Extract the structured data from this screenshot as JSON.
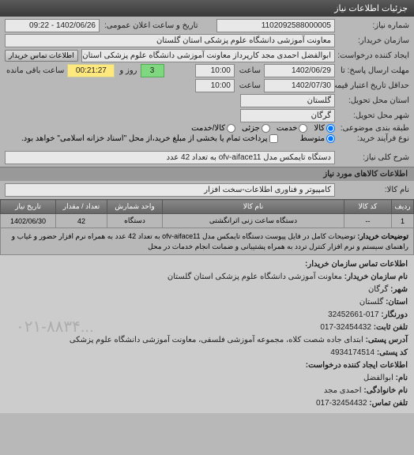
{
  "header": {
    "title": "جزئیات اطلاعات نیاز"
  },
  "form": {
    "request_no_label": "شماره نیاز:",
    "request_no": "1102092588000005",
    "announce_label": "تاریخ و ساعت اعلان عمومی:",
    "announce_value": "1402/06/26 - 09:22",
    "buyer_org_label": "سازمان خریدار:",
    "buyer_org": "معاونت آموزشی دانشگاه علوم پزشکی استان گلستان",
    "requester_label": "ایجاد کننده درخواست:",
    "requester": "ابوالفضل احمدی مجد کارپرداز معاونت آموزشی دانشگاه علوم پزشکی استان گل",
    "contact_btn": "اطلاعات تماس خریدار",
    "deadline_from_label": "مهلت ارسال پاسخ: تا",
    "deadline_date": "1402/06/29",
    "time_label": "ساعت",
    "deadline_time": "10:00",
    "days_field": "3",
    "days_label": "روز و",
    "remain_time": "00:21:27",
    "remain_label": "ساعت باقی مانده",
    "valid_until_label": "حداقل تاریخ اعتبار قیمت: تا تاریخ:",
    "valid_date": "1402/07/30",
    "valid_time": "10:00",
    "province_label": "استان محل تحویل:",
    "province": "گلستان",
    "city_label": "شهر محل تحویل:",
    "city": "گرگان",
    "category_label": "طبقه بندی موضوعی:",
    "cat_goods": "کالا",
    "cat_service": "خدمت",
    "cat_partial": "جزئی",
    "cat_goods_service": "کالا/خدمت",
    "process_label": "نوع فرآیند خرید:",
    "proc_mid": "متوسط",
    "pay_note": "پرداخت تمام یا بخشی از مبلغ خرید،از محل \"اسناد خزانه اسلامی\" خواهد بود.",
    "desc_label": "شرح کلی نیاز:",
    "desc_value": "دستگاه تایمکس مدل ofv-aiface11 به تعداد 42 عدد"
  },
  "goods_section": {
    "title": "اطلاعات کالاهای مورد نیاز",
    "group_label": "نام کالا:",
    "group_value": "کامپیوتر و فناوری اطلاعات-سخت افزار"
  },
  "table": {
    "headers": [
      "ردیف",
      "کد کالا",
      "نام کالا",
      "واحد شمارش",
      "تعداد / مقدار",
      "تاریخ نیاز"
    ],
    "row": {
      "idx": "1",
      "code": "--",
      "name": "دستگاه ساعت زنی اثرانگشتی",
      "unit": "دستگاه",
      "qty": "42",
      "date": "1402/06/30"
    },
    "notes_label": "توضیحات خریدار:",
    "notes": "توضیحات کامل در فایل پیوست دستگاه تایمکس مدل ofv-aiface11 به تعداد 42 عدد به همراه نرم افزار حضور و غیاب و راهنمای سیستم و نرم افزار کنترل تردد به همراه پشتیبانی و ضمانت انجام خدمات در محل"
  },
  "contact": {
    "section1": "اطلاعات تماس سازمان خریدار:",
    "org_name_l": "نام سازمان خریدار:",
    "org_name": "معاونت آموزشی دانشگاه علوم پزشکی استان گلستان",
    "city_l": "شهر:",
    "city": "گرگان",
    "prov_l": "استان:",
    "prov": "گلستان",
    "fax_l": "دورنگار:",
    "fax": "017-32452661",
    "phone_l": "تلفن ثابت:",
    "phone": "32454432-017",
    "addr_l": "آدرس پستی:",
    "addr": "ابتدای جاده شصت کلاه، مجموعه آموزشی فلسفی، معاونت آموزشی دانشگاه علوم پزشکی",
    "post_l": "کد پستی:",
    "post": "4934174514",
    "section2": "اطلاعات ایجاد کننده درخواست:",
    "fname_l": "نام:",
    "fname": "ابوالفضل",
    "lname_l": "نام خانوادگی:",
    "lname": "احمدی مجد",
    "cphone_l": "تلفن تماس:",
    "cphone": "32454432-017"
  },
  "watermark": "۰۲۱-۸۸۳۴..."
}
